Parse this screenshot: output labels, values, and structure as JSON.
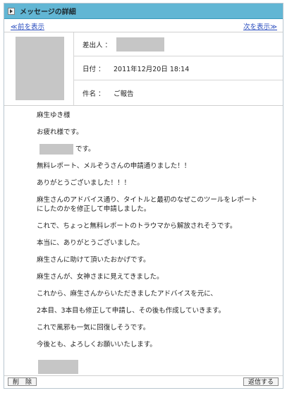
{
  "header": {
    "title": "メッセージの詳細"
  },
  "nav": {
    "prev_label": "≪前を表示",
    "next_label": "次を表示≫"
  },
  "meta": {
    "sender_label": "差出人 ：",
    "date_label": "日付 ：",
    "date_value": "2011年12月20日 18:14",
    "subject_label": "件名 ：",
    "subject_value": "ご報告"
  },
  "message": {
    "greeting": "麻生ゆき様",
    "line_otsukare": "お疲れ様です。",
    "line_desu": "です。",
    "line_1": "無料レポート、メルぞうさんの申請通りました！！",
    "line_2": "ありがとうございました！！！",
    "line_3a": "麻生さんのアドバイス通り、タイトルと最初のなぜこのツールをレポート",
    "line_3b": "にしたのかを修正して申請しました。",
    "line_4": "これで、ちょっと無料レポートのトラウマから解放されそうです。",
    "line_5": "本当に、ありがとうございました。",
    "line_6": "麻生さんに助けて頂いたおかげです。",
    "line_7": "麻生さんが、女神さまに見えてきました。",
    "line_8": "これから、麻生さんからいただきましたアドバイスを元に、",
    "line_9": "2本目、3本目も修正して申請し、その後も作成していきます。",
    "line_10": "これで風邪も一気に回復しそうです。",
    "line_11": "今後とも、よろしくお願いいたします。"
  },
  "actions": {
    "delete_label": "削　除",
    "reply_label": "返信する"
  }
}
